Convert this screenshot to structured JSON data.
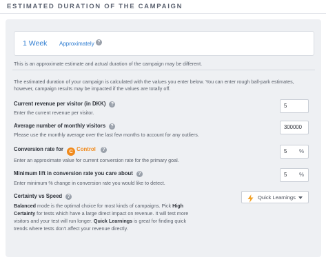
{
  "section": {
    "title": "Estimated duration of the campaign"
  },
  "estimate": {
    "value": "1 Week",
    "qualifier": "Approximately",
    "help_icon": "?"
  },
  "note": "This is an approximate estimate and actual duration of the campaign may be different.",
  "intro": "The estimated duration of your campaign is calculated with the values you enter below. You can enter rough ball-park estimates, however, campaign results may be impacted if the values are totally off.",
  "fields": {
    "revenue": {
      "label": "Current revenue per visitor (in DKK)",
      "description": "Enter the current revenue per visitor.",
      "value": "5"
    },
    "visitors": {
      "label": "Average number of monthly visitors",
      "description": "Please use the monthly average over the last few months to account for any outliers.",
      "value": "300000"
    },
    "conversion": {
      "label": "Conversion rate for",
      "badge": "C",
      "badge_color": "#f08a1c",
      "variant": "Control",
      "description": "Enter an approximate value for current conversion rate for the primary goal.",
      "value": "5",
      "unit": "%"
    },
    "lift": {
      "label": "Minimum lift in conversion rate you care about",
      "description": "Enter minimum % change in conversion rate you would like to detect.",
      "value": "5",
      "unit": "%"
    },
    "certainty": {
      "label": "Certainty vs Speed",
      "balanced_term": "Balanced",
      "balanced_text": " mode is the optimal choice for most kinds of campaigns. Pick ",
      "high_term": "High Certainty",
      "high_text": " for tests which have a large direct impact on revenue. It will test more visitors and your test will run longer. ",
      "quick_term": "Quick Learnings",
      "quick_text": " is great for finding quick trends where tests don't affect your revenue directly.",
      "selected": "Quick Learnings",
      "selected_icon": "lightning-bolt-icon"
    }
  },
  "colors": {
    "accent": "#2f7dd1",
    "control": "#f08a1c",
    "bolt": "#f2a32a"
  }
}
